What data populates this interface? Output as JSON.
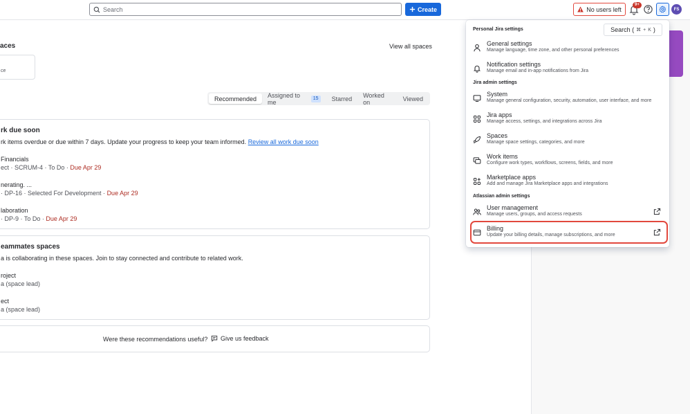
{
  "topbar": {
    "search_placeholder": "Search",
    "create_label": "Create",
    "no_users_label": "No users left",
    "notification_count": "9+",
    "avatar_initials": "FS"
  },
  "spaces": {
    "title": "aces",
    "view_all": "View all spaces",
    "card_line1": "",
    "card_line2": "ce"
  },
  "tabs": [
    {
      "label": "Recommended"
    },
    {
      "label": "Assigned to me",
      "count": "15"
    },
    {
      "label": "Starred"
    },
    {
      "label": "Worked on"
    },
    {
      "label": "Viewed"
    }
  ],
  "work_due": {
    "title": "rk due soon",
    "description": "rk items overdue or due within 7 days. Update your progress to keep your team informed. ",
    "link": "Review all work due soon",
    "items": [
      {
        "title": "Financials",
        "meta": "ect · SCRUM-4 · To Do · ",
        "due": "Due Apr 29"
      },
      {
        "title": "nerating. ...",
        "meta": "· DP-16 · Selected For Development · ",
        "due": "Due Apr 29"
      },
      {
        "title": "laboration",
        "meta": "· DP-9 · To Do · ",
        "due": "Due Apr 29"
      }
    ]
  },
  "teammates": {
    "title": "eammates spaces",
    "description": "a is collaborating in these spaces. Join to stay connected and contribute to related work.",
    "items": [
      {
        "title": "roject",
        "meta": "a (space lead)"
      },
      {
        "title": "ect",
        "meta": "a (space lead)"
      }
    ]
  },
  "feedback": {
    "question": "Were these recommendations useful?",
    "button": "Give us feedback"
  },
  "menu": {
    "personal_header": "Personal Jira settings",
    "search_label": "Search (",
    "search_key1": "⌘",
    "search_plus": "+",
    "search_key2": "K",
    "search_close": ")",
    "jira_admin_header": "Jira admin settings",
    "atlassian_header": "Atlassian admin settings",
    "personal_items": [
      {
        "label": "General settings",
        "desc": "Manage language, time zone, and other personal preferences"
      },
      {
        "label": "Notification settings",
        "desc": "Manage email and in-app notifications from Jira"
      }
    ],
    "admin_items": [
      {
        "label": "System",
        "desc": "Manage general configuration, security, automation, user interface, and more"
      },
      {
        "label": "Jira apps",
        "desc": "Manage access, settings, and integrations across Jira"
      },
      {
        "label": "Spaces",
        "desc": "Manage space settings, categories, and more"
      },
      {
        "label": "Work items",
        "desc": "Configure work types, workflows, screens, fields, and more"
      },
      {
        "label": "Marketplace apps",
        "desc": "Add and manage Jira Marketplace apps and integrations"
      }
    ],
    "atlassian_items": [
      {
        "label": "User management",
        "desc": "Manage users, groups, and access requests"
      },
      {
        "label": "Billing",
        "desc": "Update your billing details, manage subscriptions, and more"
      }
    ]
  },
  "colors": {
    "brand": "#1868DB",
    "due": "#AE2E24",
    "highlight": "#E2483D"
  }
}
